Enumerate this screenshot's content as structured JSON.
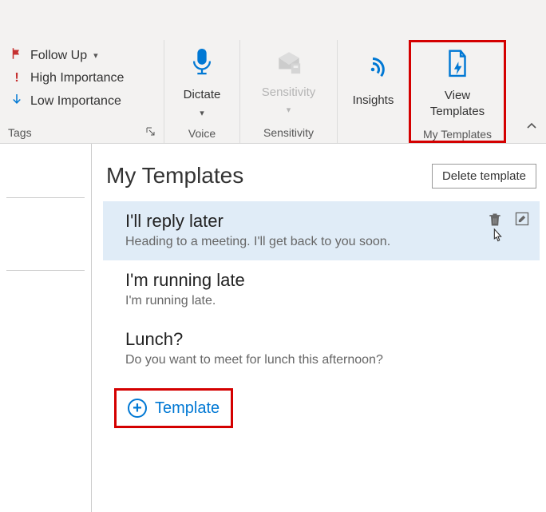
{
  "ribbon": {
    "tags": {
      "follow_up": "Follow Up",
      "high_importance": "High Importance",
      "low_importance": "Low Importance",
      "group_label": "Tags"
    },
    "voice": {
      "dictate": "Dictate",
      "group_label": "Voice"
    },
    "sensitivity": {
      "label": "Sensitivity",
      "group_label": "Sensitivity"
    },
    "insights": {
      "label": "Insights"
    },
    "my_templates": {
      "view_label": "View Templates",
      "group_label": "My Templates"
    }
  },
  "pane": {
    "title": "My Templates",
    "delete_button": "Delete template",
    "templates": [
      {
        "title": "I'll reply later",
        "body": "Heading to a meeting. I'll get back to you soon."
      },
      {
        "title": "I'm running late",
        "body": "I'm running late."
      },
      {
        "title": "Lunch?",
        "body": "Do you want to meet for lunch this afternoon?"
      }
    ],
    "add_label": "Template"
  }
}
